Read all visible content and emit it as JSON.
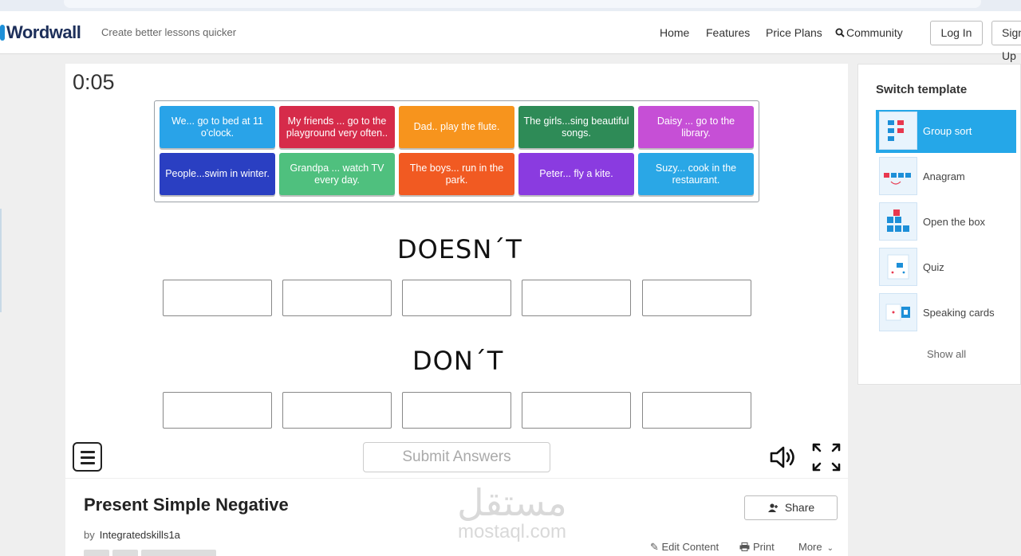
{
  "header": {
    "logo": "Wordwall",
    "tagline": "Create better lessons quicker",
    "nav": {
      "home": "Home",
      "features": "Features",
      "price_plans": "Price Plans",
      "community": "Community"
    },
    "login": "Log In",
    "signup": "Sign Up"
  },
  "activity": {
    "timer": "0:05",
    "cards": [
      {
        "text": "We... go to bed at 11 o'clock.",
        "color": "#29a3e8"
      },
      {
        "text": "My friends ... go to the playground very often..",
        "color": "#d62b4a"
      },
      {
        "text": "Dad.. play the flute.",
        "color": "#f7941d"
      },
      {
        "text": "The girls...sing beautiful songs.",
        "color": "#2e8b57"
      },
      {
        "text": "Daisy ... go to the library.",
        "color": "#c64fd6"
      },
      {
        "text": "People...swim in winter.",
        "color": "#2a3fc2"
      },
      {
        "text": "Grandpa ... watch TV every day.",
        "color": "#4fc07e"
      },
      {
        "text": "The boys... run in the park.",
        "color": "#f15a22"
      },
      {
        "text": "Peter... fly a kite.",
        "color": "#8a3be0"
      },
      {
        "text": "Suzy... cook in the restaurant.",
        "color": "#2aa7e6"
      }
    ],
    "groups": [
      "DOESN´T",
      "DON´T"
    ],
    "submit": "Submit Answers"
  },
  "info": {
    "title": "Present Simple Negative",
    "by_label": "by",
    "author": "Integratedskills1a",
    "share": "Share",
    "edit": "Edit Content",
    "print": "Print",
    "more": "More"
  },
  "watermark": {
    "arabic": "مستقل",
    "latin": "mostaql.com"
  },
  "sidebar": {
    "title": "Switch template",
    "templates": [
      {
        "label": "Group sort",
        "icon": "group-sort-icon"
      },
      {
        "label": "Anagram",
        "icon": "anagram-icon"
      },
      {
        "label": "Open the box",
        "icon": "open-the-box-icon"
      },
      {
        "label": "Quiz",
        "icon": "quiz-icon"
      },
      {
        "label": "Speaking cards",
        "icon": "speaking-cards-icon"
      }
    ],
    "show_all": "Show all"
  }
}
